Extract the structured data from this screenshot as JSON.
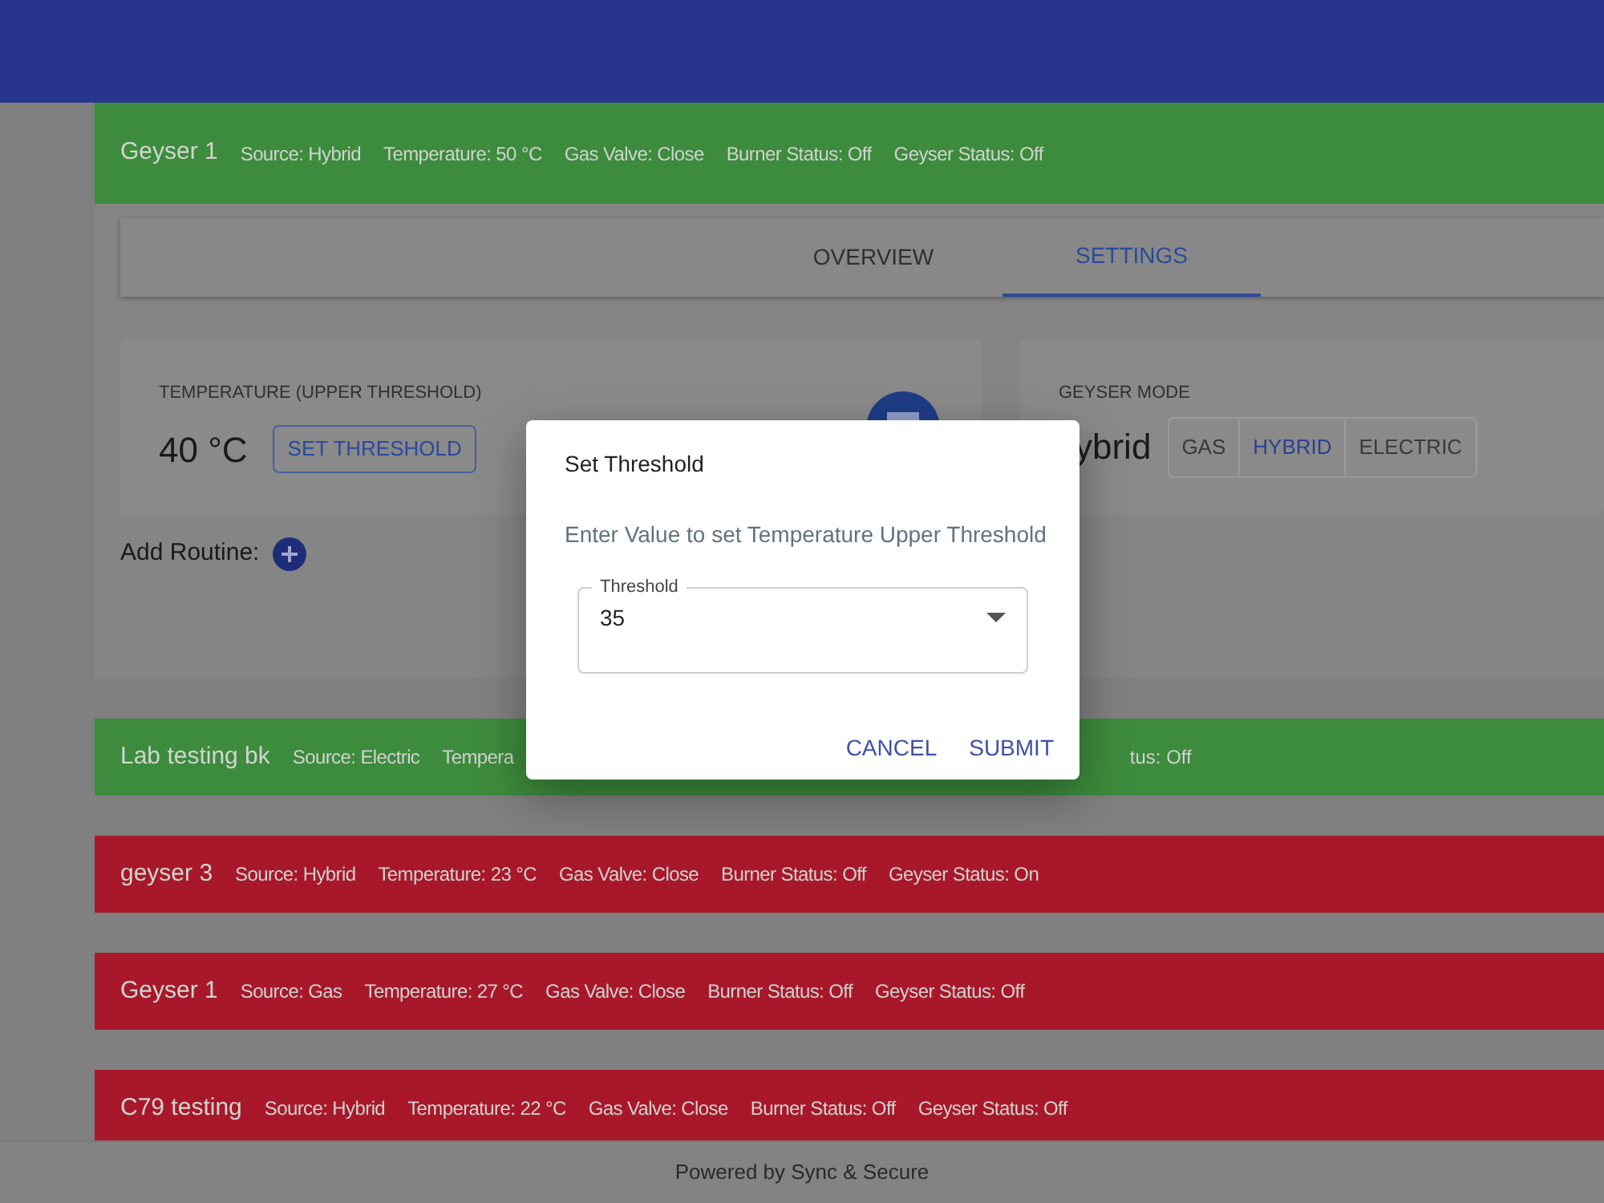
{
  "devices": [
    {
      "name": "Geyser 1",
      "color": "#3d8b3d",
      "expanded": true,
      "fields": [
        "Source: Hybrid",
        "Temperature: 50 °C",
        "Gas Valve: Close",
        "Burner Status: Off",
        "Geyser Status: Off"
      ]
    },
    {
      "name": "Lab testing bk",
      "color": "#3d8b3d",
      "expanded": false,
      "fields": [
        "Source: Electric",
        "Tempera"
      ],
      "fields_after_dialog": [
        "tus: Off"
      ]
    },
    {
      "name": "geyser 3",
      "color": "#a8182a",
      "expanded": false,
      "fields": [
        "Source: Hybrid",
        "Temperature: 23 °C",
        "Gas Valve: Close",
        "Burner Status: Off",
        "Geyser Status: On"
      ]
    },
    {
      "name": "Geyser 1",
      "color": "#a8182a",
      "expanded": false,
      "fields": [
        "Source: Gas",
        "Temperature: 27 °C",
        "Gas Valve: Close",
        "Burner Status: Off",
        "Geyser Status: Off"
      ]
    },
    {
      "name": "C79 testing",
      "color": "#a8182a",
      "expanded": false,
      "fields": [
        "Source: Hybrid",
        "Temperature: 22 °C",
        "Gas Valve: Close",
        "Burner Status: Off",
        "Geyser Status: Off"
      ]
    }
  ],
  "tabs": [
    {
      "label": "OVERVIEW",
      "selected": false
    },
    {
      "label": "SETTINGS",
      "selected": true
    }
  ],
  "temperature_card": {
    "label": "TEMPERATURE (UPPER THRESHOLD)",
    "value": "40 °C",
    "button": "SET THRESHOLD"
  },
  "mode_card": {
    "label": "GEYSER MODE",
    "value": "ybrid",
    "options": [
      {
        "label": "GAS",
        "selected": false
      },
      {
        "label": "HYBRID",
        "selected": true
      },
      {
        "label": "ELECTRIC",
        "selected": false
      }
    ]
  },
  "add_routine": "Add Routine:",
  "dialog": {
    "title": "Set Threshold",
    "message": "Enter Value to set Temperature Upper Threshold",
    "field_label": "Threshold",
    "value": "35",
    "buttons": [
      "CANCEL",
      "SUBMIT"
    ]
  },
  "footer": "Powered by Sync & Secure"
}
